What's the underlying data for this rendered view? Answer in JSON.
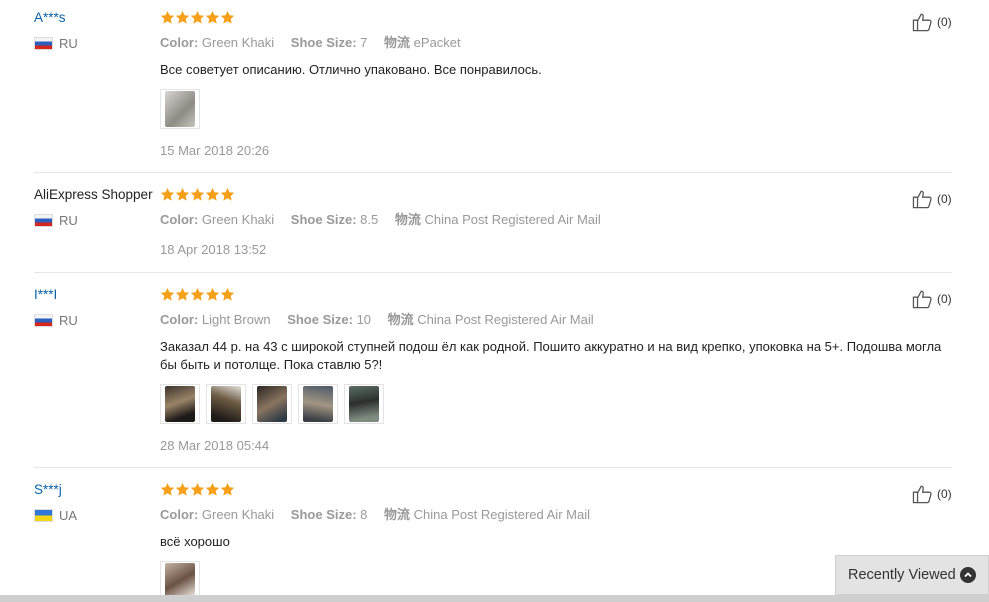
{
  "reviews": [
    {
      "user": "A***s",
      "country": "RU",
      "stars": 5,
      "color_key": "Color:",
      "color": "Green Khaki",
      "size_key": "Shoe Size:",
      "size": "7",
      "ship_key": "物流",
      "ship": "ePacket",
      "text": "Все советует описанию. Отлично упаковано. Все понравилось.",
      "date": "15 Mar 2018 20:26",
      "helpful": "(0)"
    },
    {
      "user": "AliExpress Shopper",
      "country": "RU",
      "stars": 5,
      "color_key": "Color:",
      "color": "Green Khaki",
      "size_key": "Shoe Size:",
      "size": "8.5",
      "ship_key": "物流",
      "ship": "China Post Registered Air Mail",
      "date": "18 Apr 2018 13:52",
      "helpful": "(0)"
    },
    {
      "user": "I***I",
      "country": "RU",
      "stars": 5,
      "color_key": "Color:",
      "color": "Light Brown",
      "size_key": "Shoe Size:",
      "size": "10",
      "ship_key": "物流",
      "ship": "China Post Registered Air Mail",
      "text": "Заказал 44 р. на 43 с широкой ступней подош ёл как родной. Пошито аккуратно и на вид крепко, упоковка на 5+. Подошва могла бы быть и потолще. Пока ставлю 5?!",
      "date": "28 Mar 2018 05:44",
      "helpful": "(0)"
    },
    {
      "user": "S***j",
      "country": "UA",
      "stars": 5,
      "color_key": "Color:",
      "color": "Green Khaki",
      "size_key": "Shoe Size:",
      "size": "8",
      "ship_key": "物流",
      "ship": "China Post Registered Air Mail",
      "text": "всё хорошо",
      "helpful": "(0)"
    }
  ],
  "recently_viewed": {
    "label": "Recently Viewed",
    "icon": "chevron-up-icon"
  },
  "colors": {
    "star": "#f6a01a",
    "link": "#0a62a8"
  }
}
